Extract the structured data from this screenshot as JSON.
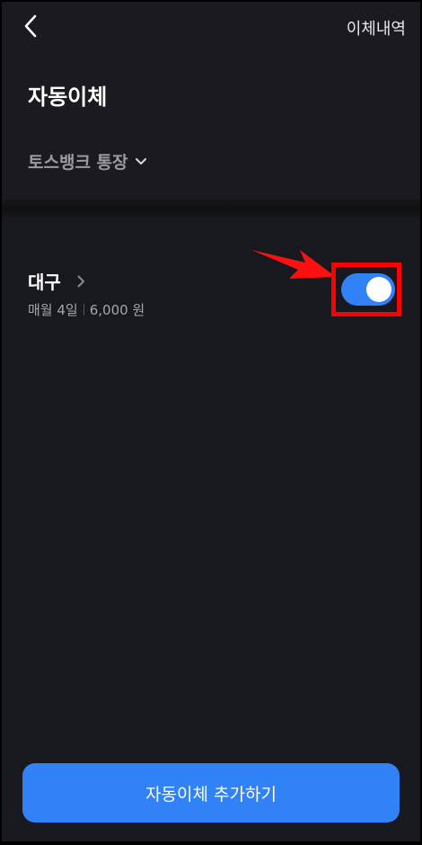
{
  "header": {
    "back_icon": "chevron-left-icon",
    "history_label": "이체내역"
  },
  "page": {
    "title": "자동이체"
  },
  "account": {
    "name": "토스뱅크 통장",
    "dropdown_icon": "chevron-down-icon"
  },
  "transfers": [
    {
      "name": "대구",
      "schedule": "매월 4일",
      "amount": "6,000 원",
      "enabled": true,
      "chevron_icon": "chevron-right-icon"
    }
  ],
  "annotation": {
    "arrow_icon": "red-arrow-icon",
    "highlight_color": "#ff0000"
  },
  "footer": {
    "add_label": "자동이체 추가하기"
  },
  "colors": {
    "background": "#18181f",
    "accent": "#3182f6",
    "text_primary": "#ffffff",
    "text_secondary": "#a6a6ae"
  }
}
